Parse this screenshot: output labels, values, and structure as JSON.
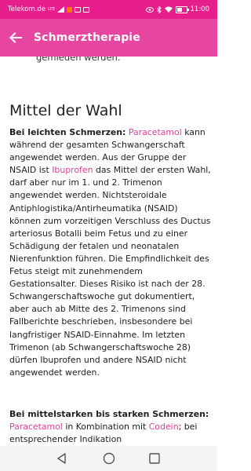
{
  "status_bar": {
    "carrier": "Telekom.de",
    "network": "LTE",
    "time": "11:00",
    "battery_level": 0.55
  },
  "app_bar": {
    "title": "Schmerztherapie"
  },
  "article": {
    "cut_text": "gemieden werden.",
    "heading": "Mittel der Wahl",
    "p1": {
      "label": "Bei leichten Schmerzen:",
      "link1": "Paracetamol",
      "text1": "kann während der gesamten Schwangerschaft angewendet werden. Aus der Gruppe der NSAID ist",
      "link2": "Ibuprofen",
      "text2": "das Mittel der ersten Wahl, darf aber nur im 1. und 2. Trimenon angewendet werden. Nichtsteroidale Antiphlogistika/Antirheumatika (NSAID) können zum vorzeitigen Verschluss des Ductus arteriosus Botalli beim Fetus und zu einer Schädigung der fetalen und neonatalen Nierenfunktion führen. Die Empfindlichkeit des Fetus steigt mit zunehmendem Gestationsalter. Dieses Risiko ist nach der 28. Schwangerschaftswoche gut dokumentiert, aber auch ab Mitte des 2. Trimenons sind Fallberichte beschrieben, insbesondere bei langfristiger NSAID-Einnahme. Im letzten Trimenon (ab Schwangerschaftswoche 28) dürfen Ibuprofen und andere NSAID nicht angewendet werden."
    },
    "p2": {
      "label": "Bei mittelstarken bis starken Schmerzen:",
      "link1": "Paracetamol",
      "text1": "in Kombination mit",
      "link2": "Codein",
      "text2": "; bei entsprechender Indikation"
    }
  },
  "colors": {
    "accent": "#e6469f",
    "link": "#e0409a"
  },
  "icons": {
    "back": "arrow-left-icon",
    "nav_back": "triangle-back-icon",
    "nav_home": "circle-home-icon",
    "nav_recents": "square-recents-icon"
  }
}
